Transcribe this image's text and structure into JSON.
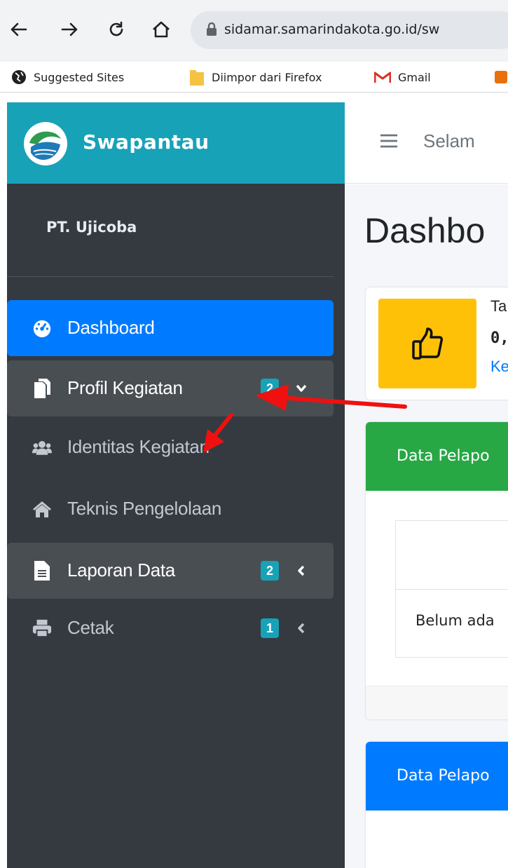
{
  "browser": {
    "url": "sidamar.samarindakota.go.id/sw",
    "bookmarks": [
      "Suggested Sites",
      "Diimpor dari Firefox",
      "Gmail"
    ]
  },
  "sidebar": {
    "brand": "Swapantau",
    "user": "PT. Ujicoba",
    "items": [
      {
        "label": "Dashboard",
        "icon": "tachometer-icon"
      },
      {
        "label": "Profil Kegiatan",
        "icon": "copy-icon",
        "badge": "2"
      },
      {
        "label": "Identitas Kegiatan",
        "icon": "users-icon"
      },
      {
        "label": "Teknis Pengelolaan",
        "icon": "home-icon"
      },
      {
        "label": "Laporan Data",
        "icon": "file-icon",
        "badge": "2"
      },
      {
        "label": "Cetak",
        "icon": "print-icon",
        "badge": "1"
      }
    ]
  },
  "topbar": {
    "welcome": "Selam"
  },
  "main": {
    "title": "Dashbo",
    "infobox": {
      "line1": "Ta",
      "line2": "0,",
      "link": "Ke"
    },
    "cards": [
      {
        "title": "Data Pelapo",
        "table_cell": "Belum ada"
      },
      {
        "title": "Data Pelapo"
      }
    ]
  },
  "colors": {
    "sidebar": "#343a40",
    "brand": "#17a2b8",
    "active": "#007bff",
    "info_icon": "#ffc107",
    "card_green": "#28a745",
    "card_blue": "#007bff",
    "annotation_arrow": "#f01010"
  }
}
